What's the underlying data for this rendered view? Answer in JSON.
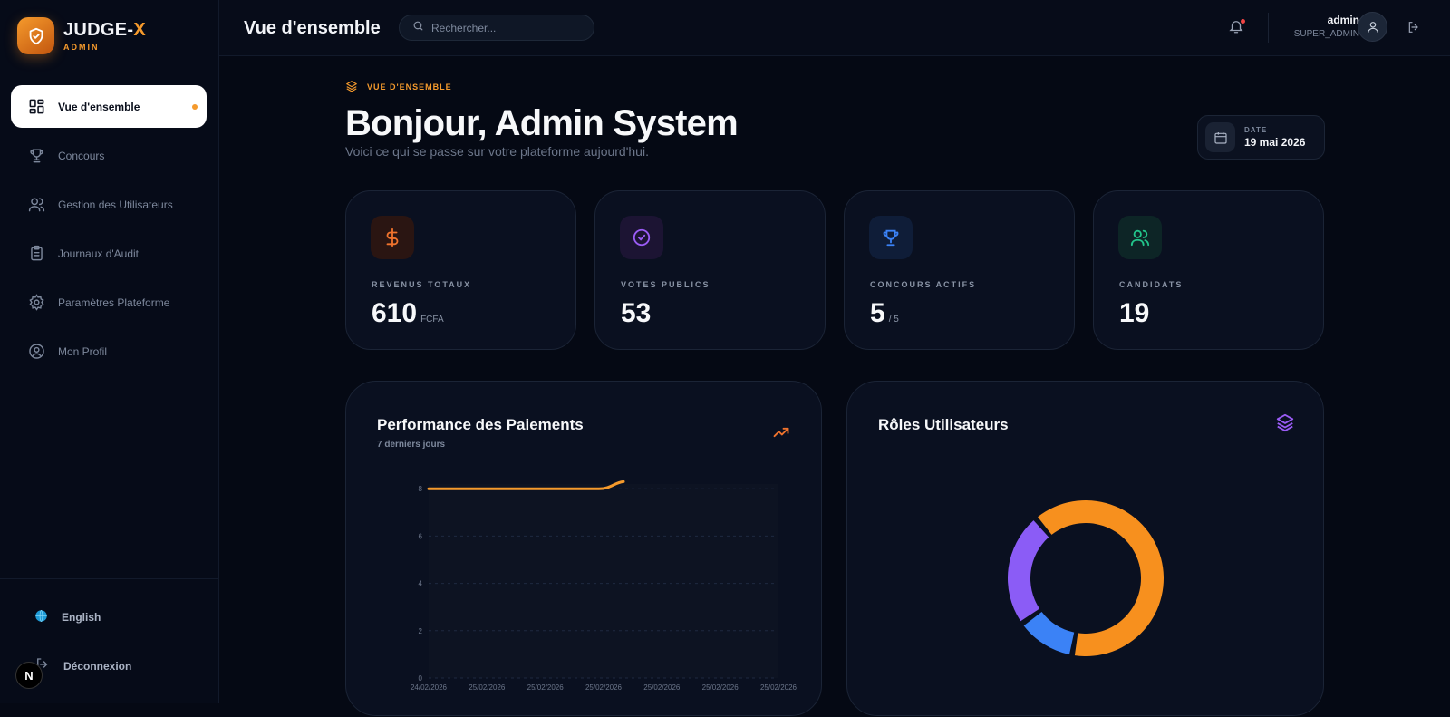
{
  "brand": {
    "name_main": "JUDGE-",
    "name_accent": "X",
    "subtitle": "ADMIN"
  },
  "sidebar": {
    "items": [
      {
        "label": "Vue d'ensemble",
        "icon": "dashboard-grid-icon",
        "active": true
      },
      {
        "label": "Concours",
        "icon": "trophy-icon"
      },
      {
        "label": "Gestion des Utilisateurs",
        "icon": "users-icon"
      },
      {
        "label": "Journaux d'Audit",
        "icon": "clipboard-list-icon"
      },
      {
        "label": "Paramètres Plateforme",
        "icon": "gear-icon"
      },
      {
        "label": "Mon Profil",
        "icon": "user-circle-icon"
      }
    ],
    "language": "English",
    "logout": "Déconnexion",
    "badge": "N"
  },
  "topbar": {
    "title": "Vue d'ensemble",
    "search_placeholder": "Rechercher...",
    "user_name": "admin",
    "user_role": "SUPER_ADMIN"
  },
  "header": {
    "kicker": "VUE D'ENSEMBLE",
    "greeting": "Bonjour, Admin System",
    "subtitle": "Voici ce qui se passe sur votre plateforme aujourd'hui.",
    "date_label": "DATE",
    "date_value": "19 mai 2026"
  },
  "stats": [
    {
      "label": "REVENUS TOTAUX",
      "value": "610",
      "unit": "FCFA",
      "icon": "dollar-icon",
      "color": "#f0732d",
      "bg": "#2a1512"
    },
    {
      "label": "VOTES PUBLICS",
      "value": "53",
      "unit": "",
      "icon": "check-circle-icon",
      "color": "#9b5cf6",
      "bg": "#1c1433"
    },
    {
      "label": "CONCOURS ACTIFS",
      "value": "5",
      "unit": "/ 5",
      "icon": "trophy-icon",
      "color": "#3b82f6",
      "bg": "#0f1d38"
    },
    {
      "label": "CANDIDATS",
      "value": "19",
      "unit": "",
      "icon": "users-icon",
      "color": "#22c58b",
      "bg": "#0d2526"
    }
  ],
  "payments_panel": {
    "title": "Performance des Paiements",
    "subtitle": "7 derniers jours"
  },
  "roles_panel": {
    "title": "Rôles Utilisateurs"
  },
  "chart_data": [
    {
      "type": "line",
      "title": "Performance des Paiements",
      "subtitle": "7 derniers jours",
      "x": [
        "24/02/2026",
        "25/02/2026",
        "25/02/2026",
        "25/02/2026",
        "25/02/2026",
        "25/02/2026",
        "25/02/2026"
      ],
      "series": [
        {
          "values": [
            8,
            8,
            8,
            8,
            8.3,
            8.3,
            8.3
          ],
          "color": "#f59a2c"
        }
      ],
      "yticks": [
        0,
        2,
        4,
        6,
        8
      ],
      "ylim": [
        0,
        8.2
      ],
      "grid": true
    },
    {
      "type": "pie",
      "title": "Rôles Utilisateurs",
      "donut": true,
      "series": [
        {
          "values": [
            62,
            12,
            23
          ],
          "colors": [
            "#f7901e",
            "#3b82f6",
            "#8b5cf6"
          ]
        }
      ]
    }
  ]
}
